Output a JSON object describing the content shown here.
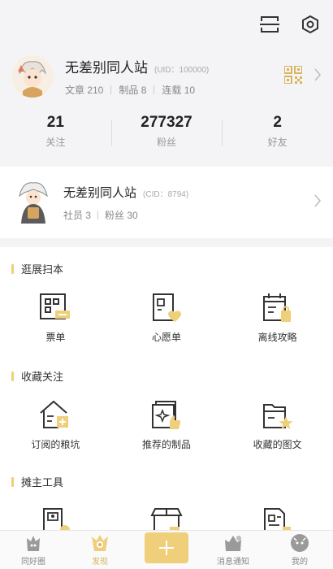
{
  "header": {
    "scan_icon": "scan-icon",
    "settings_icon": "settings-hexagon-icon"
  },
  "profile": {
    "name": "无差别同人站",
    "uid": "(UID：100000)",
    "meta": [
      {
        "label": "文章 210"
      },
      {
        "label": "制品 8"
      },
      {
        "label": "连载 10"
      }
    ]
  },
  "stats": [
    {
      "value": "21",
      "label": "关注"
    },
    {
      "value": "277327",
      "label": "粉丝"
    },
    {
      "value": "2",
      "label": "好友"
    }
  ],
  "club": {
    "name": "无差别同人站",
    "cid": "(CID：8794)",
    "meta": [
      {
        "label": "社员 3"
      },
      {
        "label": "粉丝 30"
      }
    ]
  },
  "sections": [
    {
      "title": "逛展扫本",
      "items": [
        {
          "label": "票单",
          "icon": "ticket-icon"
        },
        {
          "label": "心愿单",
          "icon": "wishlist-icon"
        },
        {
          "label": "离线攻略",
          "icon": "offline-guide-icon"
        }
      ]
    },
    {
      "title": "收藏关注",
      "items": [
        {
          "label": "订阅的粮坑",
          "icon": "subscribed-icon"
        },
        {
          "label": "推荐的制品",
          "icon": "recommended-icon"
        },
        {
          "label": "收藏的图文",
          "icon": "favorite-posts-icon"
        }
      ]
    },
    {
      "title": "摊主工具",
      "items": [
        {
          "label": "",
          "icon": "booth-icon"
        },
        {
          "label": "",
          "icon": "shop-icon"
        },
        {
          "label": "",
          "icon": "document-icon"
        }
      ]
    }
  ],
  "tabbar": [
    {
      "label": "同好圈",
      "icon": "circle-tab-icon",
      "active": false
    },
    {
      "label": "发现",
      "icon": "discover-tab-icon",
      "active": true
    },
    {
      "label": "",
      "icon": "plus-icon",
      "active": false
    },
    {
      "label": "消息通知",
      "icon": "message-tab-icon",
      "active": false
    },
    {
      "label": "我的",
      "icon": "me-tab-icon",
      "active": false
    }
  ],
  "colors": {
    "accent": "#f0cf7a",
    "active_text": "#d9b45c",
    "background": "#f4f4f6"
  }
}
